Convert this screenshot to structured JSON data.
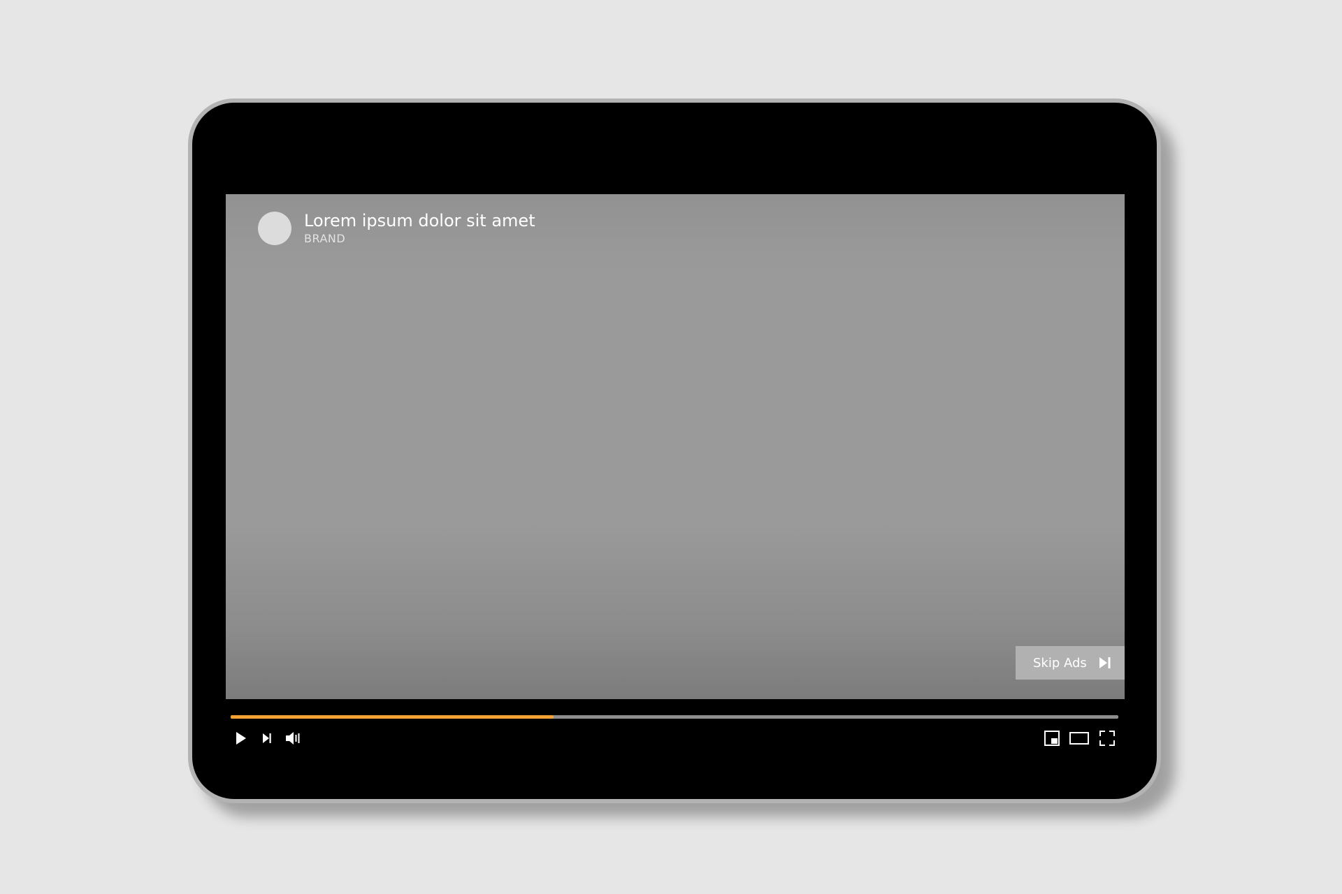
{
  "ad": {
    "title": "Lorem ipsum dolor sit amet",
    "brand": "BRAND"
  },
  "skip": {
    "label": "Skip Ads",
    "icon": "skip-next-icon"
  },
  "progress": {
    "fraction": 0.364,
    "fill_color": "#f2a234",
    "track_color": "#8e8e8e"
  },
  "controls": {
    "left": [
      "play-icon",
      "next-icon",
      "volume-icon"
    ],
    "right": [
      "miniplayer-icon",
      "theater-mode-icon",
      "fullscreen-icon"
    ]
  }
}
